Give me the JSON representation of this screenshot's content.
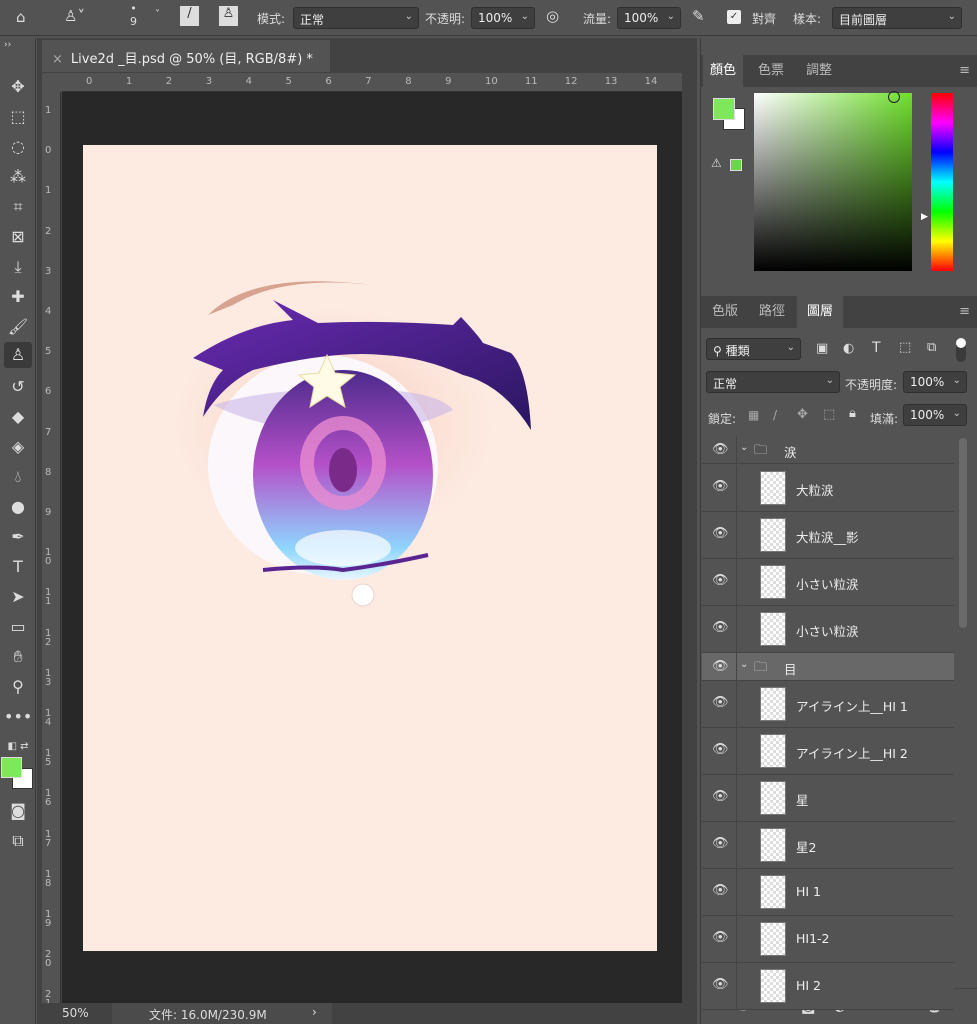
{
  "options_bar": {
    "brush_size": "9",
    "mode_label": "模式:",
    "mode_value": "正常",
    "opacity_label": "不透明:",
    "opacity_value": "100%",
    "flow_label": "流量:",
    "flow_value": "100%",
    "aligned_label": "對齊",
    "aligned_checked": true,
    "sample_label": "樣本:",
    "sample_value": "目前圖層"
  },
  "document": {
    "tab_title": "Live2d _目.psd @ 50% (目, RGB/8#) *",
    "zoom": "50%",
    "file_info": "文件: 16.0M/230.9M",
    "canvas_color": "#fdebe1"
  },
  "rulers": {
    "horizontal": [
      "0",
      "1",
      "2",
      "3",
      "4",
      "5",
      "6",
      "7",
      "8",
      "9",
      "10",
      "11",
      "12",
      "13",
      "14"
    ],
    "vertical": [
      "1",
      "0",
      "1",
      "2",
      "3",
      "4",
      "5",
      "6",
      "7",
      "8",
      "9",
      "1 0",
      "1 1",
      "1 2",
      "1 3",
      "1 4",
      "1 5",
      "1 6",
      "1 7",
      "1 8",
      "1 9",
      "2 0",
      "2 1"
    ]
  },
  "colors": {
    "foreground": "#7ee85a",
    "background": "#ffffff",
    "accent": "#6cd64a"
  },
  "color_panel": {
    "tabs": [
      "顏色",
      "色票",
      "調整"
    ],
    "active": "顏色"
  },
  "layers_panel": {
    "tabs": [
      "色版",
      "路徑",
      "圖層"
    ],
    "active": "圖層",
    "filter_label": "種類",
    "blend_mode": "正常",
    "opacity_label": "不透明度:",
    "opacity_value": "100%",
    "lock_label": "鎖定:",
    "fill_label": "填滿:",
    "fill_value": "100%",
    "layers": [
      {
        "name": "涙",
        "type": "group"
      },
      {
        "name": "大粒涙",
        "type": "layer"
      },
      {
        "name": "大粒涙__影",
        "type": "layer"
      },
      {
        "name": "小さい粒涙",
        "type": "layer"
      },
      {
        "name": "小さい粒涙",
        "type": "layer"
      },
      {
        "name": "目",
        "type": "group",
        "selected": true
      },
      {
        "name": "アイライン上__HI 1",
        "type": "layer"
      },
      {
        "name": "アイライン上__HI 2",
        "type": "layer"
      },
      {
        "name": "星",
        "type": "layer"
      },
      {
        "name": "星2",
        "type": "layer"
      },
      {
        "name": "HI 1",
        "type": "layer"
      },
      {
        "name": "HI1-2",
        "type": "layer"
      },
      {
        "name": "HI 2",
        "type": "layer"
      }
    ]
  }
}
